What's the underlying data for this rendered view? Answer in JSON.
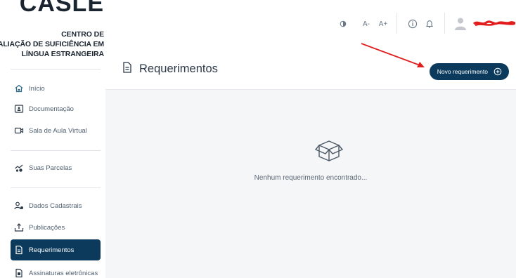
{
  "brand": {
    "logo_text": "CASLE",
    "line1": "CENTRO DE",
    "line2": "AVALIAÇÃO DE SUFICIÊNCIA EM",
    "line3": "LÍNGUA ESTRANGEIRA"
  },
  "topbar": {
    "theme_icon": "contrast-icon",
    "font_decrease": "A-",
    "font_increase": "A+",
    "info_icon": "info-icon",
    "notifications_icon": "bell-icon",
    "avatar_icon": "user-icon"
  },
  "sidebar": {
    "items": [
      {
        "label": "Início",
        "icon": "home-icon"
      },
      {
        "label": "Documentação",
        "icon": "id-card-icon"
      },
      {
        "label": "Sala de Aula Virtual",
        "icon": "video-icon"
      },
      {
        "label": "Suas Parcelas",
        "icon": "coins-icon"
      },
      {
        "label": "Dados Cadastrais",
        "icon": "user-settings-icon"
      },
      {
        "label": "Publicações",
        "icon": "upload-icon"
      },
      {
        "label": "Requerimentos",
        "icon": "document-icon",
        "active": true
      },
      {
        "label": "Assinaturas eletrônicas",
        "icon": "signature-icon"
      }
    ]
  },
  "header": {
    "title": "Requerimentos",
    "new_button_label": "Novo requerimento"
  },
  "main": {
    "empty_text": "Nenhum requerimento encontrado..."
  },
  "colors": {
    "primary": "#0b3a5c",
    "background": "#f5f6f8",
    "annotation_arrow": "#e02020"
  }
}
